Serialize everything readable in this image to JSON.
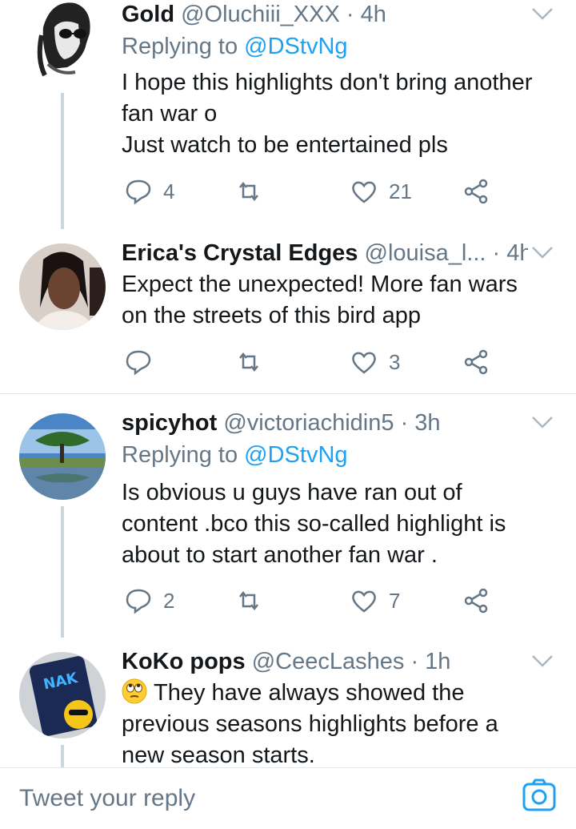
{
  "tweets": [
    {
      "name": "Gold",
      "handle": "@Oluchiii_XXX",
      "time": "· 4h",
      "replying_label": "Replying to",
      "replying_to": "@DStvNg",
      "body": [
        "I hope this highlights don't bring another",
        "fan war o",
        "Just watch to be entertained pls"
      ],
      "replies": "4",
      "retweets": "",
      "likes": "21"
    },
    {
      "name": "Erica's Crystal Edges",
      "handle": "@louisa_l...",
      "time": "· 4h",
      "body": [
        "Expect the unexpected! More fan wars",
        "on the streets of this bird app"
      ],
      "replies": "",
      "retweets": "",
      "likes": "3"
    },
    {
      "name": "spicyhot",
      "handle": "@victoriachidin5",
      "time": "· 3h",
      "replying_label": "Replying to",
      "replying_to": "@DStvNg",
      "body": [
        "Is obvious u guys have ran out of",
        "content .bco this so-called highlight is",
        "about to start another fan war ."
      ],
      "replies": "2",
      "retweets": "",
      "likes": "7"
    },
    {
      "name": "KoKo pops",
      "handle": "@CeecLashes",
      "time": "· 1h",
      "body": [
        "They have always showed the",
        "previous seasons highlights before a",
        "new season starts."
      ],
      "emoji": "face-with-rolling-eyes"
    }
  ],
  "composer": {
    "placeholder": "Tweet your reply",
    "camera_icon": "camera-icon"
  },
  "colors": {
    "link": "#1da1f2",
    "secondary": "#657786",
    "divider": "#e1e8ed",
    "thread": "#ccd6dd"
  }
}
